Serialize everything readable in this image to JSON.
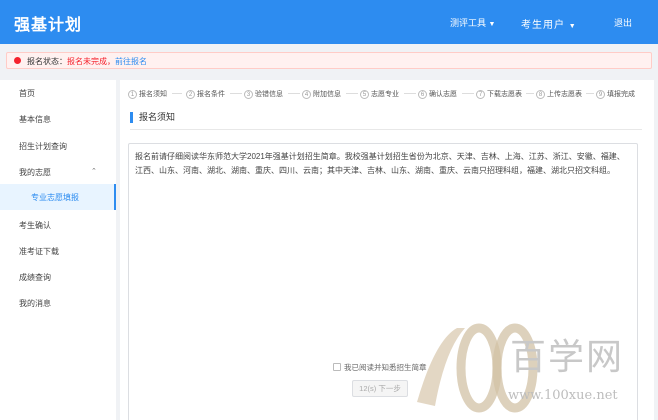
{
  "header": {
    "logo": "强基计划",
    "tools": "测评工具",
    "user": "考生用户",
    "logout": "退出"
  },
  "status": {
    "label": "报名状态：",
    "value": "报名未完成，",
    "link": "前往报名"
  },
  "sidebar": {
    "items": [
      {
        "label": "首页"
      },
      {
        "label": "基本信息"
      },
      {
        "label": "招生计划查询"
      },
      {
        "label": "我的志愿"
      },
      {
        "label": "专业志愿填报"
      },
      {
        "label": "考生确认"
      },
      {
        "label": "准考证下载"
      },
      {
        "label": "成绩查询"
      },
      {
        "label": "我的消息"
      }
    ]
  },
  "steps": [
    {
      "num": "1",
      "label": "报名须知"
    },
    {
      "num": "2",
      "label": "报名条件"
    },
    {
      "num": "3",
      "label": "验错信息"
    },
    {
      "num": "4",
      "label": "附加信息"
    },
    {
      "num": "5",
      "label": "志愿专业"
    },
    {
      "num": "6",
      "label": "确认志愿"
    },
    {
      "num": "7",
      "label": "下载志愿表"
    },
    {
      "num": "8",
      "label": "上传志愿表"
    },
    {
      "num": "9",
      "label": "填报完成"
    }
  ],
  "section": {
    "title": "报名须知"
  },
  "notice": {
    "text": "报名前请仔细阅读华东师范大学2021年强基计划招生简章。我校强基计划招生省份为北京、天津、吉林、上海、江苏、浙江、安徽、福建、江西、山东、河南、湖北、湖南、重庆、四川、云南；其中天津、吉林、山东、湖南、重庆、云南只招理科组，福建、湖北只招文科组。"
  },
  "agree": {
    "label": "我已阅读并知悉招生简章"
  },
  "next_button": {
    "label": "12(s) 下一步"
  },
  "watermark": {
    "text": "百学网",
    "url": "www.100xue.net"
  }
}
